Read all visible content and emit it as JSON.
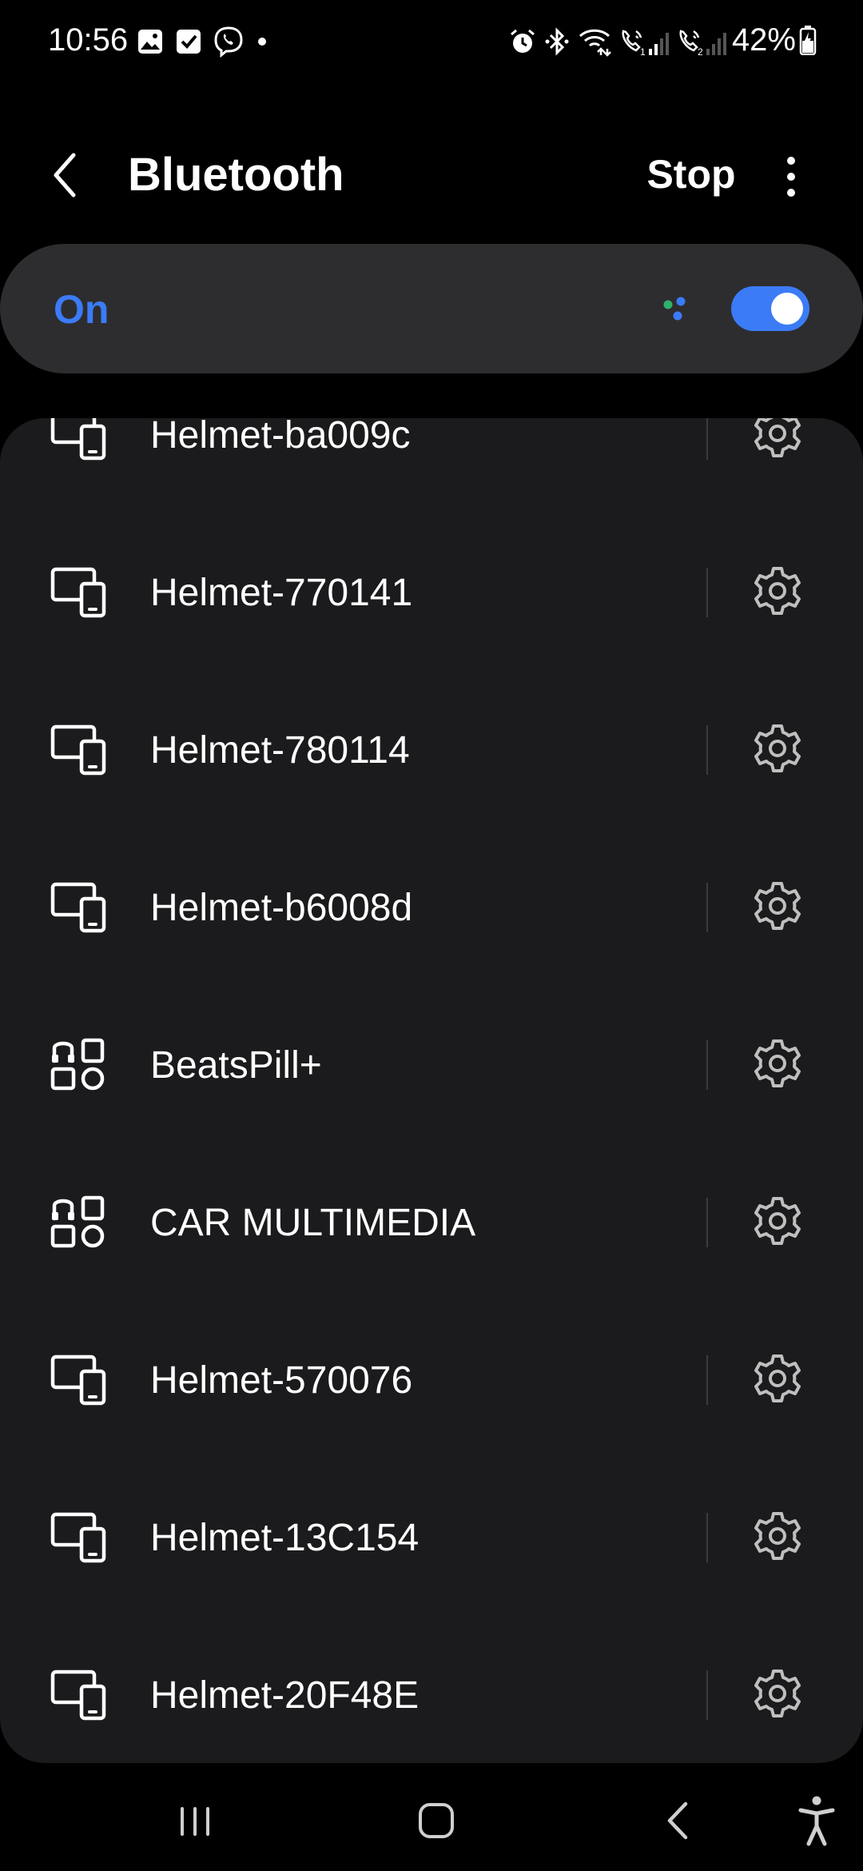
{
  "status_bar": {
    "time": "10:56",
    "battery": "42%",
    "left_icons": [
      "gallery-icon",
      "checkbox-icon",
      "viber-icon",
      "dot-icon"
    ],
    "right_icons": [
      "alarm-icon",
      "bluetooth-icon",
      "wifi-calling-icon",
      "sim1-call-icon",
      "sim2-call-icon"
    ]
  },
  "app_bar": {
    "title": "Bluetooth",
    "stop_label": "Stop"
  },
  "toggle": {
    "label": "On",
    "state": true,
    "accent_color": "#3b7bf6"
  },
  "devices": [
    {
      "name": "Helmet-ba009c",
      "icon": "device-icon"
    },
    {
      "name": "Helmet-770141",
      "icon": "device-icon"
    },
    {
      "name": "Helmet-780114",
      "icon": "device-icon"
    },
    {
      "name": "Helmet-b6008d",
      "icon": "device-icon"
    },
    {
      "name": "BeatsPill+",
      "icon": "multi-device-icon"
    },
    {
      "name": "CAR MULTIMEDIA",
      "icon": "multi-device-icon"
    },
    {
      "name": "Helmet-570076",
      "icon": "device-icon"
    },
    {
      "name": "Helmet-13C154",
      "icon": "device-icon"
    },
    {
      "name": "Helmet-20F48E",
      "icon": "device-icon"
    }
  ],
  "nav_bar": {
    "buttons": [
      "recents-icon",
      "home-icon",
      "back-icon",
      "accessibility-icon"
    ]
  }
}
